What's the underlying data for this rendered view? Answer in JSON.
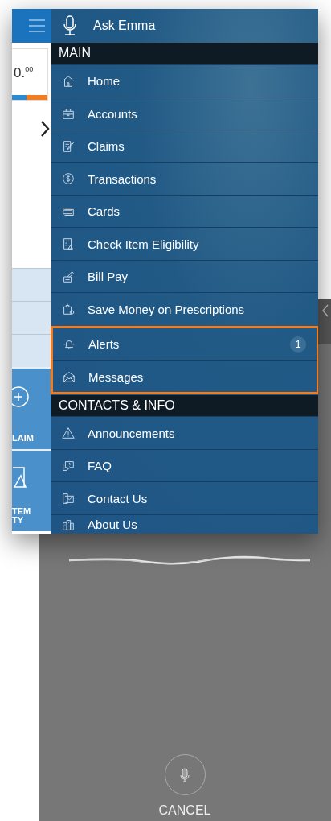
{
  "app_screen": {
    "balance": "0.",
    "balance_cents": "00",
    "tiles": [
      {
        "lines": [
          "LAIM"
        ]
      },
      {
        "lines": [
          "TEM",
          "TY"
        ]
      }
    ]
  },
  "menu": {
    "assistant": "Ask Emma",
    "sections": [
      {
        "title": "MAIN",
        "items": [
          {
            "label": "Home",
            "highlighted": false
          },
          {
            "label": "Accounts",
            "highlighted": false
          },
          {
            "label": "Claims",
            "highlighted": false
          },
          {
            "label": "Transactions",
            "highlighted": false
          },
          {
            "label": "Cards",
            "highlighted": false
          },
          {
            "label": "Check Item Eligibility",
            "highlighted": false
          },
          {
            "label": "Bill Pay",
            "highlighted": false
          },
          {
            "label": "Save Money on Prescriptions",
            "highlighted": false
          },
          {
            "label": "Alerts",
            "badge": "1",
            "highlighted": true
          },
          {
            "label": "Messages",
            "highlighted": true
          }
        ]
      },
      {
        "title": "CONTACTS & INFO",
        "items": [
          {
            "label": "Announcements",
            "highlighted": false
          },
          {
            "label": "FAQ",
            "highlighted": false
          },
          {
            "label": "Contact Us",
            "highlighted": false
          },
          {
            "label": "About Us",
            "highlighted": false
          }
        ]
      }
    ]
  },
  "voice_panel": {
    "cancel": "CANCEL"
  }
}
